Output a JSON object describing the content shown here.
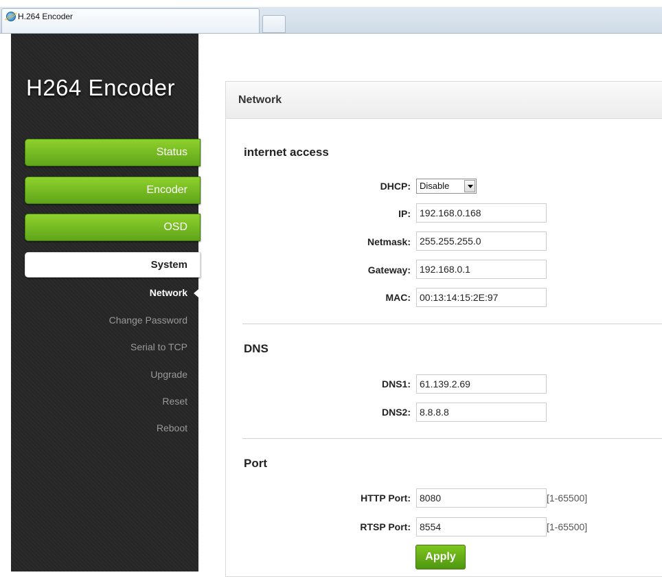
{
  "browser": {
    "tab_title": "H.264 Encoder"
  },
  "brand": "H264 Encoder",
  "nav": {
    "status": "Status",
    "encoder": "Encoder",
    "osd": "OSD",
    "system": "System",
    "sub": [
      "Network",
      "Change Password",
      "Serial to TCP",
      "Upgrade",
      "Reset",
      "Reboot"
    ]
  },
  "panel": {
    "title": "Network",
    "internet": {
      "title": "internet access",
      "dhcp_label": "DHCP:",
      "dhcp_value": "Disable",
      "ip_label": "IP:",
      "ip_value": "192.168.0.168",
      "netmask_label": "Netmask:",
      "netmask_value": "255.255.255.0",
      "gateway_label": "Gateway:",
      "gateway_value": "192.168.0.1",
      "mac_label": "MAC:",
      "mac_value": "00:13:14:15:2E:97"
    },
    "dns": {
      "title": "DNS",
      "dns1_label": "DNS1:",
      "dns1_value": "61.139.2.69",
      "dns2_label": "DNS2:",
      "dns2_value": "8.8.8.8"
    },
    "port": {
      "title": "Port",
      "http_label": "HTTP Port:",
      "http_value": "8080",
      "http_hint": "[1-65500]",
      "rtsp_label": "RTSP Port:",
      "rtsp_value": "8554",
      "rtsp_hint": "[1-65500]"
    },
    "apply": "Apply"
  },
  "colors": {
    "accent_green": "#6ab41f",
    "sidebar_bg": "#262626"
  }
}
